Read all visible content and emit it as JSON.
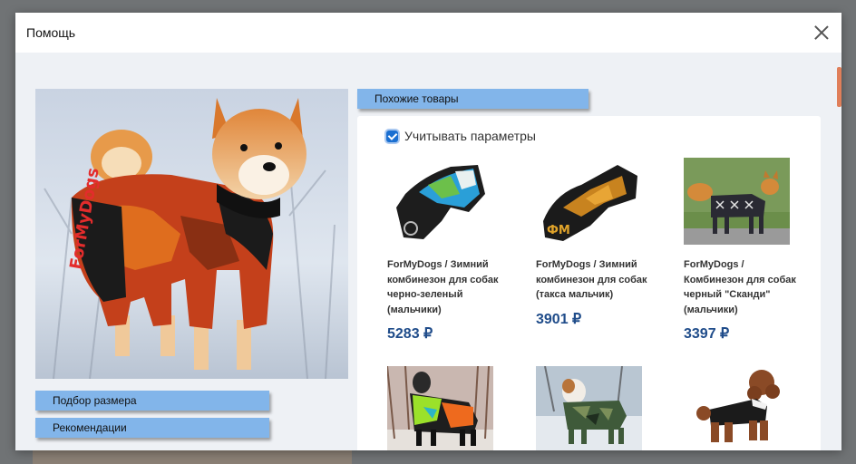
{
  "modal": {
    "title": "Помощь"
  },
  "left": {
    "size_button": "Подбор размера",
    "recommend_button": "Рекомендации"
  },
  "similar": {
    "tab_label": "Похожие товары",
    "checkbox_label": "Учитывать параметры",
    "checkbox_checked": true,
    "products": [
      {
        "title": "ForMyDogs / Зимний комбинезон для собак черно-зеленый (мальчики)",
        "price": "5283 ₽"
      },
      {
        "title": "ForMyDogs / Зимний комбинезон для собак (такса мальчик)",
        "price": "3901 ₽"
      },
      {
        "title": "ForMyDogs / Комбинезон для собак черный \"Сканди\" (мальчики)",
        "price": "3397 ₽"
      },
      {
        "title": "",
        "price": ""
      },
      {
        "title": "",
        "price": ""
      },
      {
        "title": "",
        "price": ""
      }
    ]
  },
  "colors": {
    "button_blue": "#82b5ea",
    "price_blue": "#1f4c8a",
    "checkbox_blue": "#1a6fd1"
  }
}
